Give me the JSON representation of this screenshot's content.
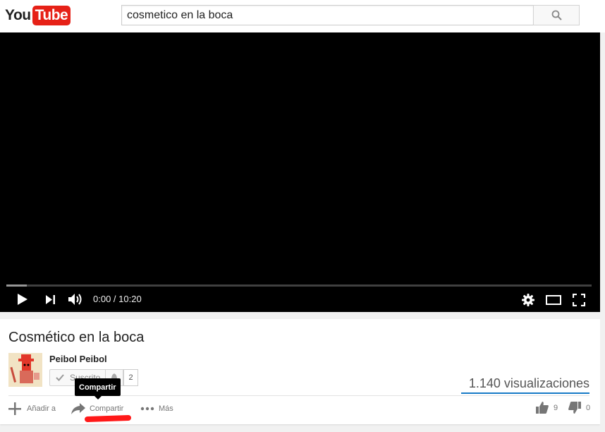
{
  "logo": {
    "you": "You",
    "tube": "Tube"
  },
  "search": {
    "value": "cosmetico en la boca"
  },
  "player": {
    "time": "0:00 / 10:20",
    "progress_loaded": 0.035
  },
  "video": {
    "title": "Cosmético en la boca",
    "channel": "Peibol Peibol",
    "subscribe_label": "Suscrito",
    "subscriber_count": "2",
    "views": "1.140 visualizaciones"
  },
  "actions": {
    "add_label": "Añadir a",
    "share_label": "Compartir",
    "more_label": "Más",
    "tooltip": "Compartir"
  },
  "ratings": {
    "likes": "9",
    "dislikes": "0"
  },
  "colors": {
    "brand_red": "#e62117",
    "accent_blue": "#167ac6",
    "annotation_red": "#ff0000"
  }
}
